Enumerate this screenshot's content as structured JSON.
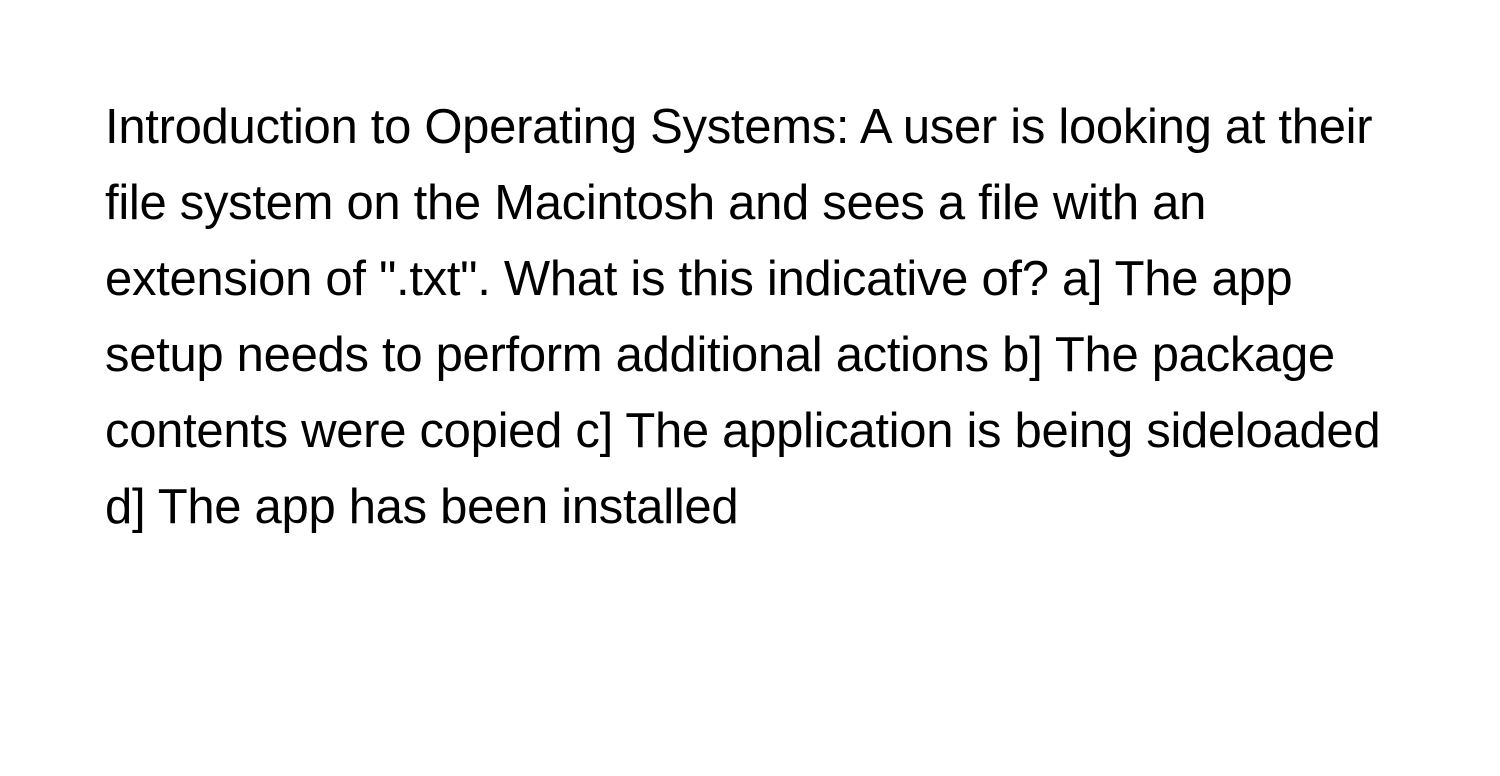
{
  "question": {
    "full_text": "Introduction to Operating Systems: A user is looking at their file system on the Macintosh and sees a file with an extension of \".txt\". What is this indicative of? a] The app setup needs to perform additional actions b] The package contents were copied c] The application is being sideloaded d] The app has been installed"
  }
}
